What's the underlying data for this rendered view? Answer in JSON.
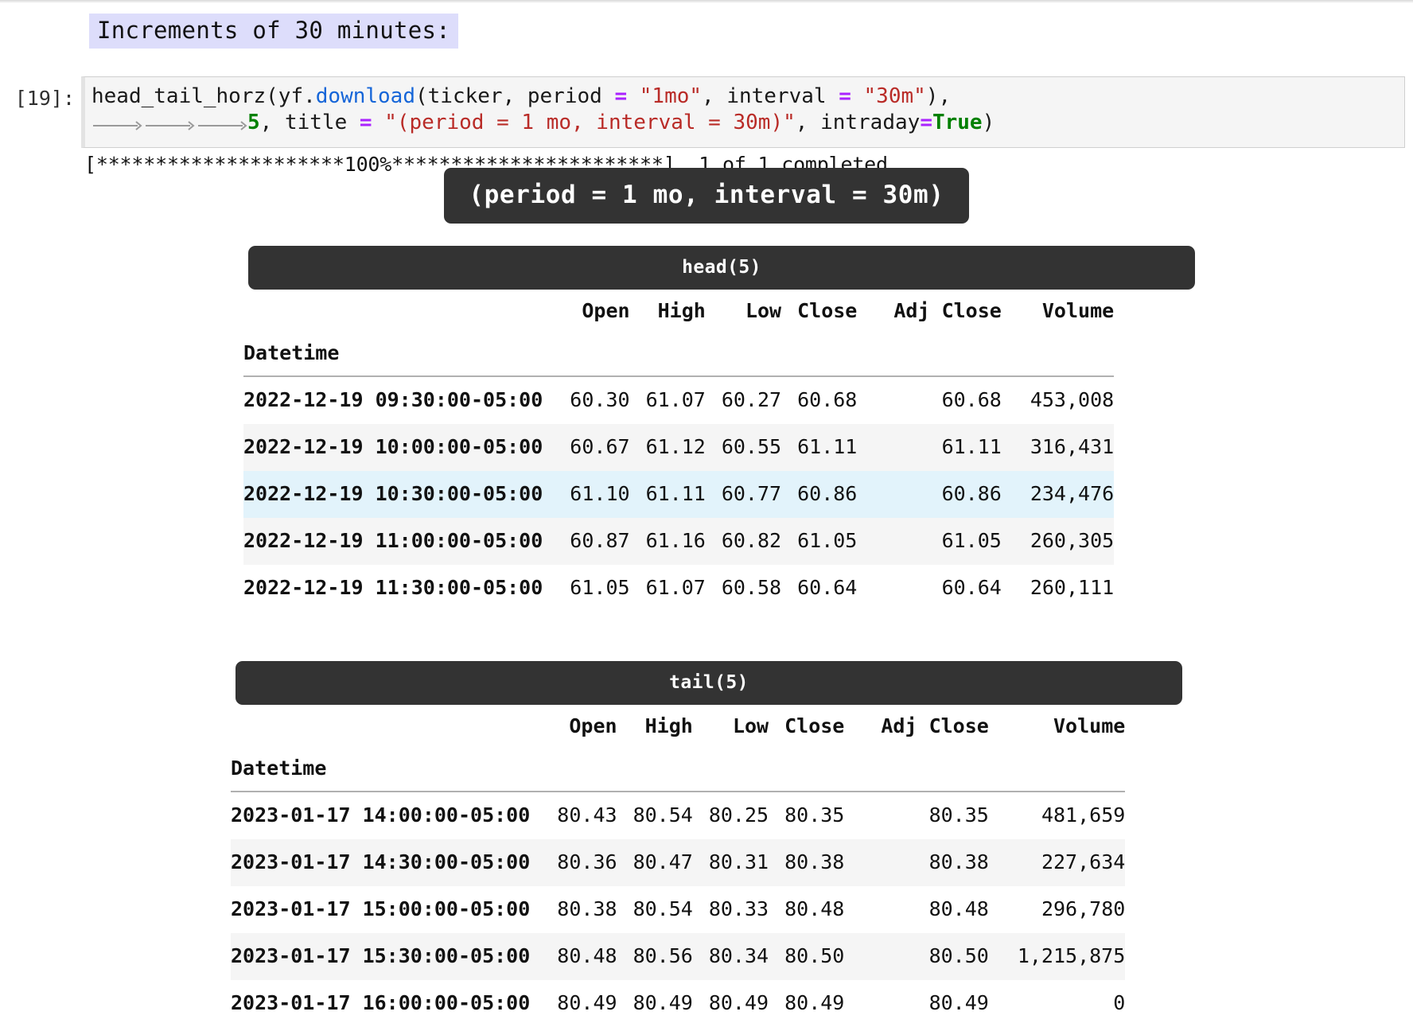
{
  "markdown": {
    "heading": "Increments of 30 minutes:"
  },
  "input_cell": {
    "prompt": "[19]:",
    "line1": {
      "seg1": "head_tail_horz(yf.",
      "fn": "download",
      "seg2": "(ticker, period ",
      "op1": "=",
      "str1": " \"1mo\"",
      "seg3": ", interval ",
      "op2": "=",
      "str2": " \"30m\"",
      "seg4": "),"
    },
    "line2": {
      "num": "5",
      "seg1": ", title ",
      "op1": "=",
      "str1": " \"(period = 1 mo, interval = 30m)\"",
      "seg2": ", intraday",
      "op2": "=",
      "kw": "True",
      "seg3": ")"
    }
  },
  "stdout": {
    "progress": "[*********************100%***********************]  1 of 1 completed"
  },
  "output": {
    "banner_title": "(period = 1 mo, interval = 30m)",
    "tables": [
      {
        "caption": "head(5)",
        "index_name": "Datetime",
        "columns": [
          "Open",
          "High",
          "Low",
          "Close",
          "Adj Close",
          "Volume"
        ],
        "rows": [
          {
            "index": "2022-12-19 09:30:00-05:00",
            "values": [
              "60.30",
              "61.07",
              "60.27",
              "60.68",
              "60.68",
              "453,008"
            ],
            "style": "plain"
          },
          {
            "index": "2022-12-19 10:00:00-05:00",
            "values": [
              "60.67",
              "61.12",
              "60.55",
              "61.11",
              "61.11",
              "316,431"
            ],
            "style": "odd"
          },
          {
            "index": "2022-12-19 10:30:00-05:00",
            "values": [
              "61.10",
              "61.11",
              "60.77",
              "60.86",
              "60.86",
              "234,476"
            ],
            "style": "hover"
          },
          {
            "index": "2022-12-19 11:00:00-05:00",
            "values": [
              "60.87",
              "61.16",
              "60.82",
              "61.05",
              "61.05",
              "260,305"
            ],
            "style": "odd"
          },
          {
            "index": "2022-12-19 11:30:00-05:00",
            "values": [
              "61.05",
              "61.07",
              "60.58",
              "60.64",
              "60.64",
              "260,111"
            ],
            "style": "plain"
          }
        ]
      },
      {
        "caption": "tail(5)",
        "index_name": "Datetime",
        "columns": [
          "Open",
          "High",
          "Low",
          "Close",
          "Adj Close",
          "Volume"
        ],
        "rows": [
          {
            "index": "2023-01-17 14:00:00-05:00",
            "values": [
              "80.43",
              "80.54",
              "80.25",
              "80.35",
              "80.35",
              "481,659"
            ],
            "style": "plain"
          },
          {
            "index": "2023-01-17 14:30:00-05:00",
            "values": [
              "80.36",
              "80.47",
              "80.31",
              "80.38",
              "80.38",
              "227,634"
            ],
            "style": "odd"
          },
          {
            "index": "2023-01-17 15:00:00-05:00",
            "values": [
              "80.38",
              "80.54",
              "80.33",
              "80.48",
              "80.48",
              "296,780"
            ],
            "style": "plain"
          },
          {
            "index": "2023-01-17 15:30:00-05:00",
            "values": [
              "80.48",
              "80.56",
              "80.34",
              "80.50",
              "80.50",
              "1,215,875"
            ],
            "style": "odd"
          },
          {
            "index": "2023-01-17 16:00:00-05:00",
            "values": [
              "80.49",
              "80.49",
              "80.49",
              "80.49",
              "80.49",
              "0"
            ],
            "style": "plain"
          }
        ]
      }
    ]
  },
  "colors": {
    "banner_bg": "#333333",
    "banner_fg": "#ffffff",
    "md_highlight": "#ddddfb",
    "code_bg": "#f5f5f5",
    "row_odd": "#f5f5f5",
    "row_hover": "#e2f3fb",
    "string_token": "#b92b27",
    "function_token": "#1565d8",
    "operator_token": "#aa22ff",
    "keyword_token": "#008000"
  }
}
